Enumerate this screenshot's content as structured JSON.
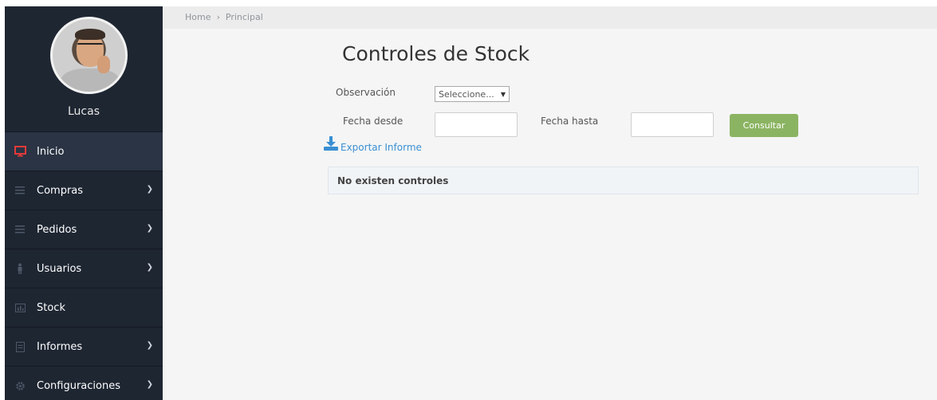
{
  "user": {
    "name": "Lucas"
  },
  "breadcrumb": {
    "items": [
      "Home",
      "Principal"
    ],
    "separator": "›"
  },
  "sidebar": {
    "items": [
      {
        "label": "Inicio",
        "icon": "monitor-icon",
        "active": true,
        "has_chevron": false
      },
      {
        "label": "Compras",
        "icon": "menu-icon",
        "active": false,
        "has_chevron": true
      },
      {
        "label": "Pedidos",
        "icon": "menu-icon",
        "active": false,
        "has_chevron": true
      },
      {
        "label": "Usuarios",
        "icon": "user-icon",
        "active": false,
        "has_chevron": true
      },
      {
        "label": "Stock",
        "icon": "chart-icon",
        "active": false,
        "has_chevron": false
      },
      {
        "label": "Informes",
        "icon": "document-icon",
        "active": false,
        "has_chevron": true
      },
      {
        "label": "Configuraciones",
        "icon": "gear-icon",
        "active": false,
        "has_chevron": true
      }
    ]
  },
  "page": {
    "title": "Controles de Stock",
    "observacion_label": "Observación",
    "observacion_value": "Seleccione...",
    "fecha_desde_label": "Fecha desde",
    "fecha_desde_value": "",
    "fecha_hasta_label": "Fecha hasta",
    "fecha_hasta_value": "",
    "consultar_label": "Consultar",
    "export_label": "Exportar Informe",
    "empty_message": "No existen controles"
  },
  "colors": {
    "sidebar_bg": "#1e2632",
    "active_item_bg": "#2a3444",
    "active_icon": "#e23a3a",
    "button_green": "#8bb462",
    "link_blue": "#3a8fd3"
  }
}
